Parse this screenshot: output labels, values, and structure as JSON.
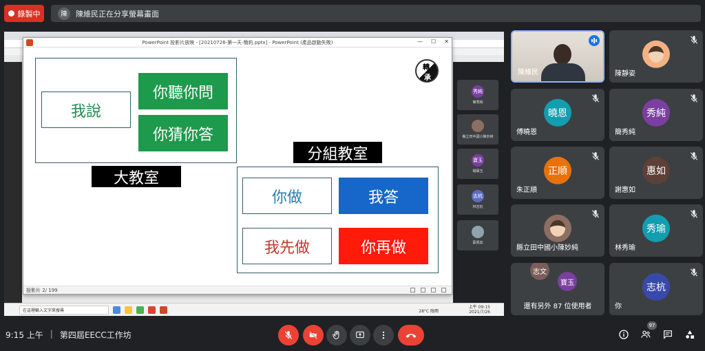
{
  "recording": {
    "label": "錄製中"
  },
  "share_banner": {
    "text": "陳維民正在分享螢幕畫面",
    "avatar_text": "陳"
  },
  "ppt": {
    "title": "PowerPoint 投影片放映 - [20210726-第一天-簡約.pptx] - PowerPoint (產品啟動失敗)",
    "status": "投影片 2/ 199",
    "seal_top": "轉",
    "seal_bottom": "承"
  },
  "slide": {
    "big_room": {
      "label": "大教室",
      "left_box": "我說",
      "right_top": "你聽你問",
      "right_bottom": "你猜你答"
    },
    "group_room": {
      "label": "分組教室",
      "tl": "你做",
      "tr": "我答",
      "bl": "我先做",
      "br": "你再做"
    },
    "colors": {
      "green": "#1e9a4c",
      "blue": "#1667c9",
      "red": "#ff1a0a",
      "text_green": "#1e8a50",
      "text_blue": "#2a7db0",
      "text_red": "#c0392b"
    }
  },
  "taskbar": {
    "search_placeholder": "在這裡輸入文字來搜尋",
    "temp": "28°C 陰雨",
    "time": "上午 09:15",
    "date": "2021/7/26"
  },
  "mini_strip": [
    {
      "initial": "秀純",
      "name": "簡秀純",
      "color": "#7b3fa0"
    },
    {
      "initial": "",
      "name": "縣立田中國小陳妙純",
      "color": "#8d6e63"
    },
    {
      "initial": "寶玉",
      "name": "楊寶玉",
      "color": "#7b3fa0"
    },
    {
      "initial": "志杭",
      "name": "林志杭",
      "color": "#5c6bc0"
    },
    {
      "initial": "",
      "name": "蔡佩如",
      "color": "#90a4ae"
    }
  ],
  "participants": [
    {
      "name": "陳維民",
      "initial": "",
      "color": "#5f6368",
      "video": true,
      "speaking": true
    },
    {
      "name": "陳靜姿",
      "initial": "",
      "color": "#f4b183",
      "video": false,
      "photo": true
    },
    {
      "name": "傅曉恩",
      "initial": "曉恩",
      "color": "#129eaf"
    },
    {
      "name": "簡秀純",
      "initial": "秀純",
      "color": "#7b3fa0"
    },
    {
      "name": "朱正順",
      "initial": "正順",
      "color": "#e8710a"
    },
    {
      "name": "謝惠如",
      "initial": "惠如",
      "color": "#5d4037"
    },
    {
      "name": "縣立田中國小陳妙純",
      "initial": "",
      "color": "#8d6e63",
      "photo": true
    },
    {
      "name": "林秀瑜",
      "initial": "秀瑜",
      "color": "#129eaf"
    },
    {
      "name": "還有另外 87 位使用者",
      "initial": "",
      "color": "",
      "others": true,
      "others_a": "志文",
      "others_b": "寶玉"
    },
    {
      "name": "你",
      "initial": "志杭",
      "color": "#3949ab"
    }
  ],
  "bottom": {
    "time": "9:15 上午",
    "meeting": "第四屆EECC工作坊",
    "people_count": "97"
  }
}
